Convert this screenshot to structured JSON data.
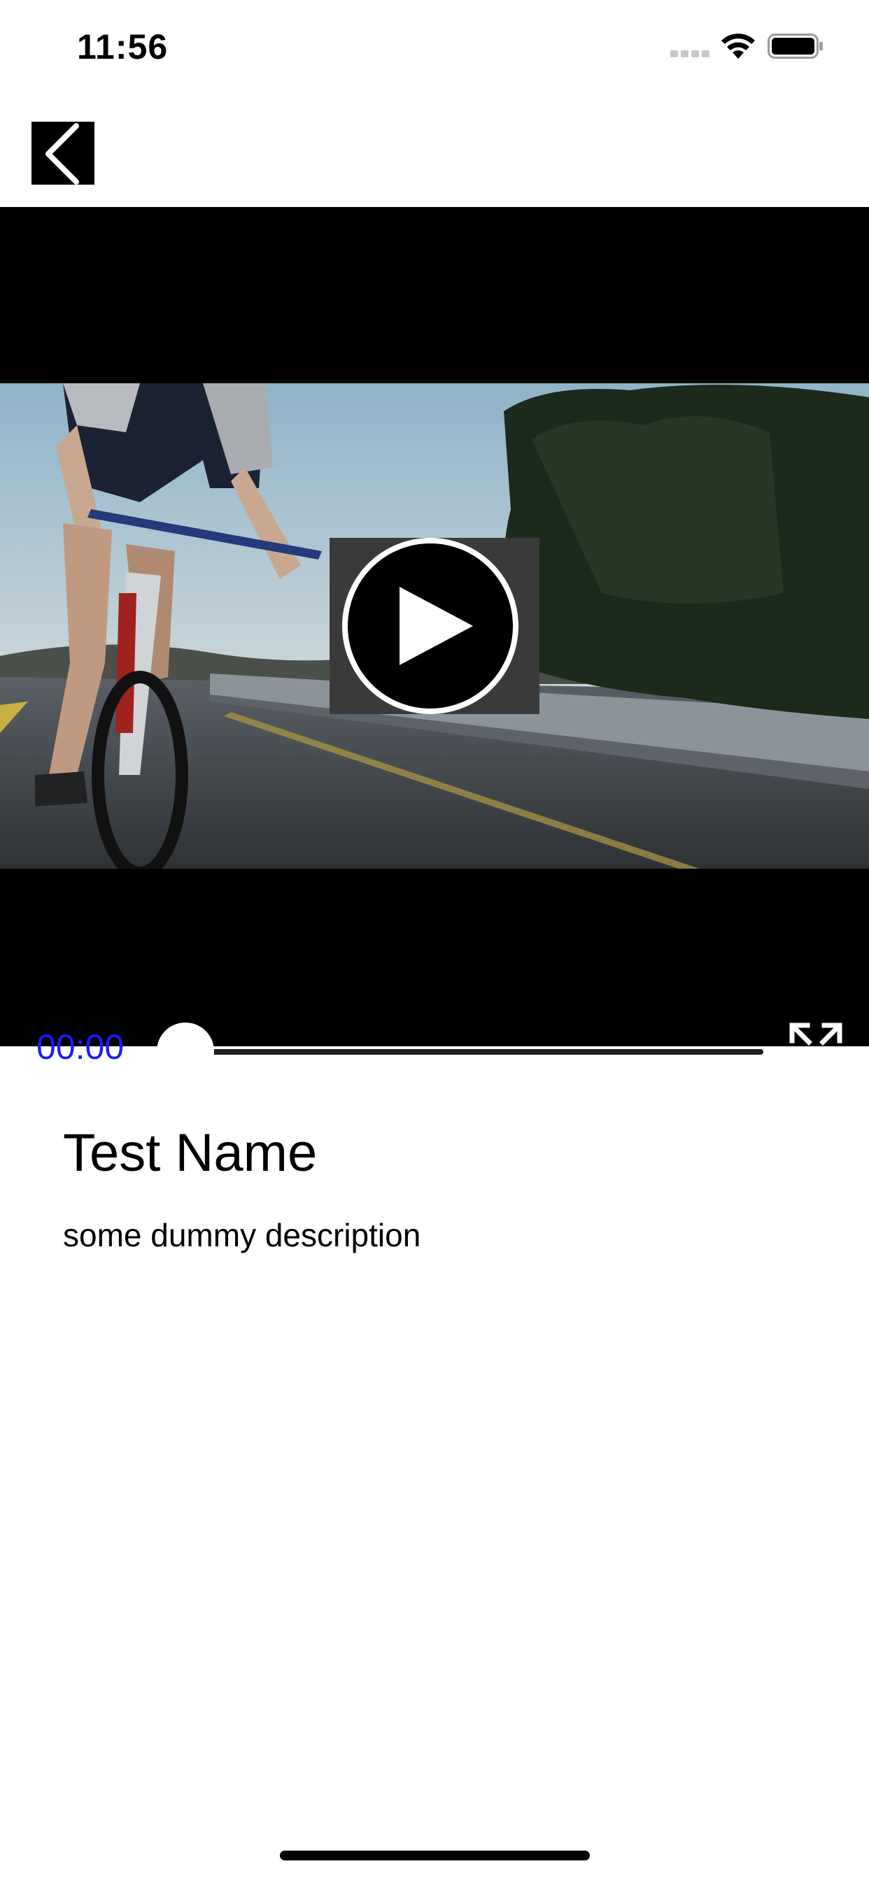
{
  "status_bar": {
    "time": "11:56"
  },
  "nav": {
    "back_icon": "chevron-left-icon"
  },
  "player": {
    "current_time": "00:00",
    "progress": 0,
    "play_icon": "play-icon",
    "fullscreen_icon": "expand-icon",
    "time_color": "#1a1aff"
  },
  "video": {
    "title": "Test Name",
    "description": "some dummy description"
  }
}
